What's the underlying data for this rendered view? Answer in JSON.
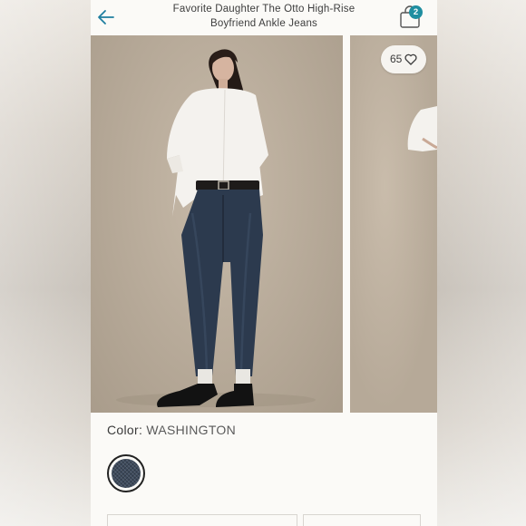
{
  "header": {
    "title_line1": "Favorite Daughter The Otto High-Rise",
    "title_line2": "Boyfriend Ankle Jeans",
    "bag_count": "2"
  },
  "gallery": {
    "like_count": "65"
  },
  "product": {
    "color_label": "Color:",
    "color_value": "WASHINGTON"
  },
  "colors": {
    "accent": "#1f8ea0",
    "back_arrow": "#1f7fa0"
  }
}
